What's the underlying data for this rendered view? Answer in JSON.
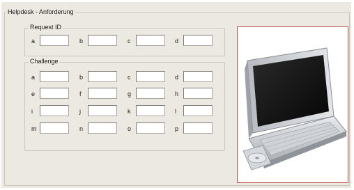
{
  "window": {
    "title": "Helpdesk - Anforderung"
  },
  "request_id": {
    "legend": "Request ID",
    "fields": [
      {
        "label": "a",
        "value": ""
      },
      {
        "label": "b",
        "value": ""
      },
      {
        "label": "c",
        "value": ""
      },
      {
        "label": "d",
        "value": ""
      }
    ]
  },
  "challenge": {
    "legend": "Challenge",
    "fields": [
      {
        "label": "a",
        "value": ""
      },
      {
        "label": "b",
        "value": ""
      },
      {
        "label": "c",
        "value": ""
      },
      {
        "label": "d",
        "value": ""
      },
      {
        "label": "e",
        "value": ""
      },
      {
        "label": "f",
        "value": ""
      },
      {
        "label": "g",
        "value": ""
      },
      {
        "label": "h",
        "value": ""
      },
      {
        "label": "i",
        "value": ""
      },
      {
        "label": "j",
        "value": ""
      },
      {
        "label": "k",
        "value": ""
      },
      {
        "label": "l",
        "value": ""
      },
      {
        "label": "m",
        "value": ""
      },
      {
        "label": "n",
        "value": ""
      },
      {
        "label": "o",
        "value": ""
      },
      {
        "label": "p",
        "value": ""
      }
    ]
  },
  "image": {
    "subject": "laptop-icon",
    "frame_color": "#c85050"
  }
}
